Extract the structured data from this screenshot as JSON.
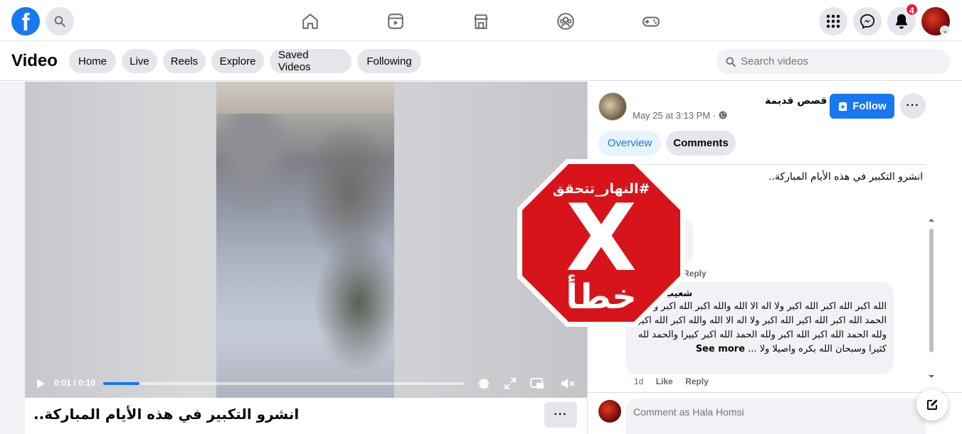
{
  "topbar": {
    "logo_letter": "f",
    "notification_count": "4"
  },
  "subbar": {
    "title": "Video",
    "pills": [
      "Home",
      "Live",
      "Reels",
      "Explore",
      "Saved Videos",
      "Following"
    ],
    "search_placeholder": "Search videos"
  },
  "video": {
    "time": "0:01 / 0:10",
    "progress_fraction": 0.1,
    "caption": "انشرو التكبير في هذه الأيام المباركة.."
  },
  "post": {
    "page_name": "قصص قديمة",
    "date": "May 25 at 3:13 PM · ",
    "follow_label": "Follow",
    "tabs": [
      "Overview",
      "Comments"
    ],
    "text": "انشرو التكبير في هذه الأيام المباركة.."
  },
  "comments": {
    "reply_label": "Reply",
    "author": "شعيب",
    "text": "الله اكبر الله اكبر الله اكبر ولا اله الا الله والله اكبر الله اكبر ولله الحمد الله اكبر الله اكبر الله اكبر ولا اله الا الله والله اكبر الله اكبر ولله الحمد الله اكبر الله اكبر ولله الحمد الله اكبر كبيرا والحمد لله كثيرا وسبحان الله بكره واصيلا ولا ...",
    "see_more": "See more",
    "time_ago": "1d",
    "like_label": "Like",
    "reply_label2": "Reply"
  },
  "composer": {
    "placeholder": "Comment as Hala Homsi"
  },
  "stamp": {
    "hashtag": "#النهار_تتحقق",
    "mark": "X",
    "verdict": "خطأ",
    "color": "#d7141a"
  }
}
